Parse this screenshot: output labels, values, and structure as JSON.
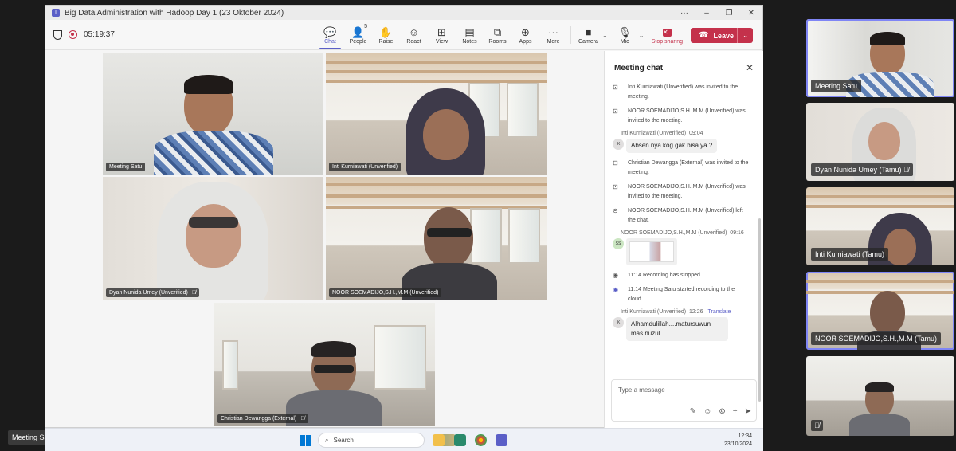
{
  "window": {
    "title": "Big Data Administration with Hadoop Day 1 (23 Oktober 2024)",
    "controls": [
      "···",
      "–",
      "❐",
      "✕"
    ]
  },
  "toolbar": {
    "timer": "05:19:37",
    "buttons": [
      {
        "label": "Chat",
        "icon": "chat-icon",
        "glyph": "💬"
      },
      {
        "label": "People",
        "icon": "people-icon",
        "glyph": "👤",
        "badge": "5"
      },
      {
        "label": "Raise",
        "icon": "hand-icon",
        "glyph": "✋"
      },
      {
        "label": "React",
        "icon": "smile-icon",
        "glyph": "☺"
      },
      {
        "label": "View",
        "icon": "grid-icon",
        "glyph": "⊞"
      },
      {
        "label": "Notes",
        "icon": "notes-icon",
        "glyph": "▤"
      },
      {
        "label": "Rooms",
        "icon": "rooms-icon",
        "glyph": "⧉"
      },
      {
        "label": "Apps",
        "icon": "apps-icon",
        "glyph": "⊕"
      },
      {
        "label": "More",
        "icon": "more-icon",
        "glyph": "···"
      }
    ],
    "camera_label": "Camera",
    "mic_label": "Mic",
    "stop_sharing_label": "Stop sharing",
    "leave_label": "Leave"
  },
  "tiles": [
    {
      "name": "Meeting Satu",
      "mic_off": false
    },
    {
      "name": "Inti Kurniawati (Unverified)",
      "mic_off": false
    },
    {
      "name": "Dyan Nunida Umey (Unverified)",
      "mic_off": true
    },
    {
      "name": "NOOR SOEMADIJO,S.H.,M.M (Unverified)",
      "mic_off": false
    },
    {
      "name": "Christian Dewangga (External)",
      "mic_off": true
    }
  ],
  "chat": {
    "title": "Meeting chat",
    "events": [
      {
        "kind": "sys",
        "icon": "invite-icon",
        "text": "Inti Kurniawati (Unverified) was invited to the meeting."
      },
      {
        "kind": "sys",
        "icon": "invite-icon",
        "text": "NOOR SOEMADIJO,S.H.,M.M (Unverified) was invited to the meeting."
      },
      {
        "kind": "msg",
        "sender": "Inti Kurniawati (Unverified)",
        "time": "09:04",
        "initials": "IK",
        "text": "Absen nya kog gak bisa ya ?"
      },
      {
        "kind": "sys",
        "icon": "invite-icon",
        "text": "Christian Dewangga (External) was invited to the meeting."
      },
      {
        "kind": "sys",
        "icon": "invite-icon",
        "text": "NOOR SOEMADIJO,S.H.,M.M (Unverified) was invited to the meeting."
      },
      {
        "kind": "sys",
        "icon": "leave-icon",
        "text": "NOOR SOEMADIJO,S.H.,M.M (Unverified) left the chat."
      },
      {
        "kind": "img",
        "sender": "NOOR SOEMADIJO,S.H.,M.M (Unverified)",
        "time": "09:16",
        "initials": "SS"
      },
      {
        "kind": "sys",
        "icon": "record-icon",
        "text": "11:14   Recording has stopped."
      },
      {
        "kind": "sys",
        "icon": "record-icon",
        "text": "11:14   Meeting Satu started recording to the cloud"
      },
      {
        "kind": "msg",
        "sender": "Inti Kurniawati (Unverified)",
        "time": "12:26",
        "translate": "Translate",
        "initials": "IK",
        "text": "Alhamdulillah....matursuwun mas nuzul"
      }
    ],
    "compose_placeholder": "Type a message"
  },
  "gallery": [
    {
      "name": "Meeting Satu",
      "selected": true
    },
    {
      "name": "Dyan Nunida Umey (Tamu)",
      "selected": false
    },
    {
      "name": "Inti Kurniawati (Tamu)",
      "selected": false
    },
    {
      "name": "NOOR SOEMADIJO,S.H.,M.M (Tamu)",
      "selected": true
    },
    {
      "name": "",
      "selected": false
    }
  ],
  "self_label": "Meeting Satu",
  "taskbar": {
    "search_label": "Search",
    "time": "12:34",
    "date": "23/10/2024"
  }
}
